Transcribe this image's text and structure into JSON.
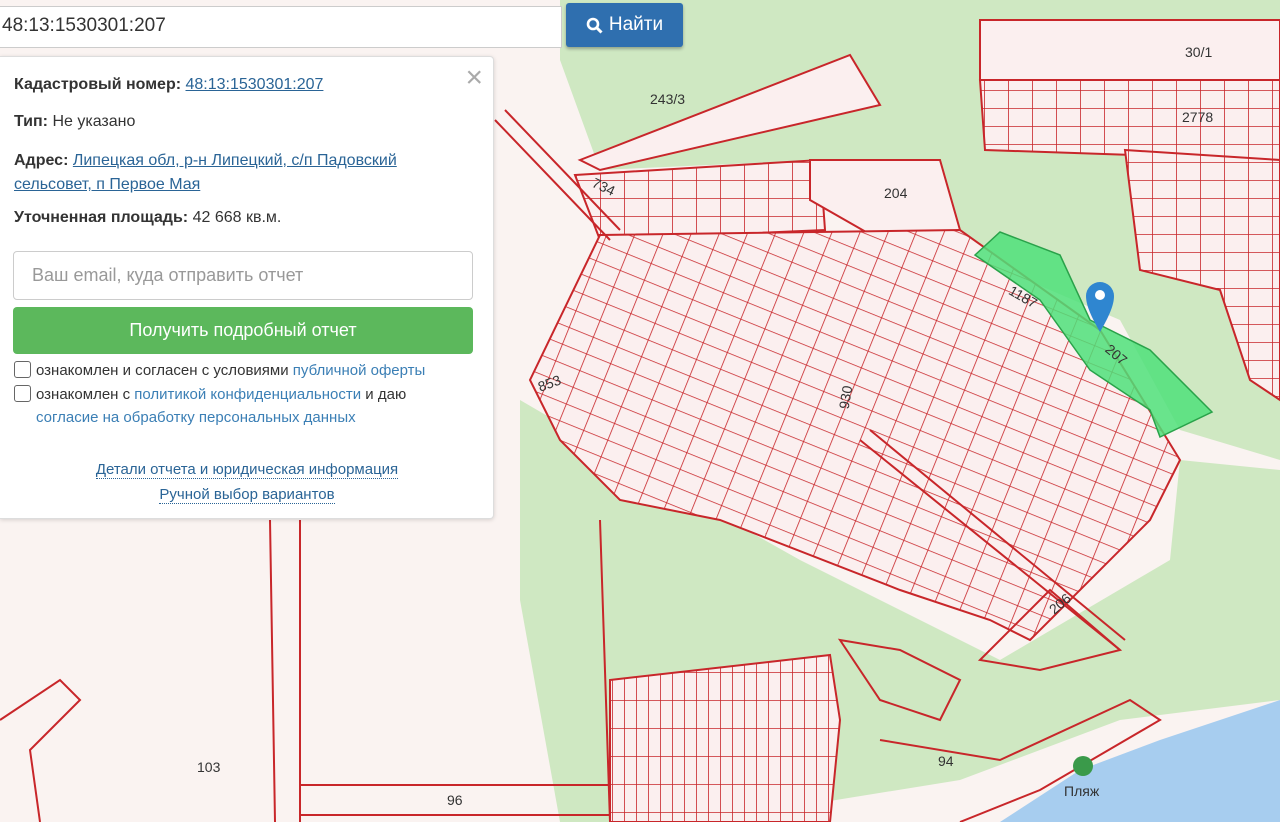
{
  "search": {
    "value": "48:13:1530301:207",
    "button_label": "Найти"
  },
  "panel": {
    "cadastral_label": "Кадастровый номер:",
    "cadastral_value": "48:13:1530301:207",
    "type_label": "Тип:",
    "type_value": "Не указано",
    "address_label": "Адрес:",
    "address_line1": "Липецкая обл, р-н Липецкий, с/п Падовский",
    "address_line2": "сельсовет, п Первое Мая",
    "area_label": "Уточненная площадь:",
    "area_value": "42 668 кв.м.",
    "email_placeholder": "Ваш email, куда отправить отчет",
    "report_button": "Получить подробный отчет",
    "consent1_text": "ознакомлен и согласен с условиями ",
    "consent1_link": "публичной оферты",
    "consent2_text": "ознакомлен с ",
    "consent2_link": "политикой конфиденциальности",
    "consent2_mid": " и даю",
    "consent2_link2": "согласие на обработку персональных данных",
    "details_link": "Детали отчета и юридическая информация",
    "manual_link": "Ручной выбор вариантов"
  },
  "map": {
    "labels": [
      "30/1",
      "2778",
      "243/3",
      "734",
      "204",
      "1187",
      "207",
      "930",
      "853",
      "206",
      "103",
      "96",
      "94",
      "Пляж"
    ],
    "colors": {
      "parcel_line": "#c8262a",
      "selected": "#4fe07a",
      "green": "#cfe8c2",
      "water": "#a7cdef"
    }
  }
}
